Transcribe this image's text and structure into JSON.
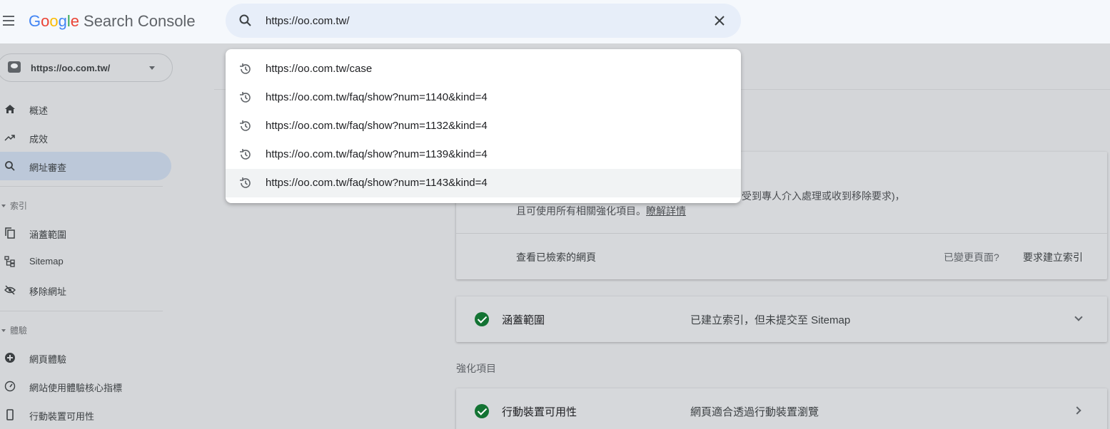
{
  "header": {
    "logo_letters": [
      "G",
      "o",
      "o",
      "g",
      "l",
      "e"
    ],
    "product_name": "Search Console",
    "search_value": "https://oo.com.tw/"
  },
  "suggestions": [
    "https://oo.com.tw/case",
    "https://oo.com.tw/faq/show?num=1140&kind=4",
    "https://oo.com.tw/faq/show?num=1132&kind=4",
    "https://oo.com.tw/faq/show?num=1139&kind=4",
    "https://oo.com.tw/faq/show?num=1143&kind=4"
  ],
  "sidebar": {
    "property": "https://oo.com.tw/",
    "items": [
      {
        "label": "概述",
        "icon": "home-icon"
      },
      {
        "label": "成效",
        "icon": "trending-up-icon"
      },
      {
        "label": "網址審查",
        "icon": "search-icon",
        "active": true
      }
    ],
    "section_index": "索引",
    "index_items": [
      {
        "label": "涵蓋範圍",
        "icon": "copy-icon"
      },
      {
        "label": "Sitemap",
        "icon": "sitemap-icon"
      },
      {
        "label": "移除網址",
        "icon": "eye-off-icon"
      }
    ],
    "section_experience": "體驗",
    "experience_items": [
      {
        "label": "網頁體驗",
        "icon": "plus-circle-icon"
      },
      {
        "label": "網站使用體驗核心指標",
        "icon": "speedometer-icon"
      },
      {
        "label": "行動裝置可用性",
        "icon": "phone-icon"
      }
    ]
  },
  "main": {
    "card1": {
      "line1": "受到專人介入處理或收到移除要求)，",
      "line2": "且可使用所有相關強化項目。",
      "learn_more": "瞭解詳情",
      "view_crawled": "查看已檢索的網頁",
      "page_changed": "已變更頁面?",
      "request_index": "要求建立索引"
    },
    "coverage": {
      "title": "涵蓋範圍",
      "status": "已建立索引，但未提交至 Sitemap"
    },
    "enhancements_label": "強化項目",
    "mobile": {
      "title": "行動裝置可用性",
      "status": "網頁適合透過行動裝置瀏覽"
    }
  },
  "colors": {
    "google_blue": "#4285f4",
    "google_red": "#ea4335",
    "google_yellow": "#fbbc05",
    "google_green": "#34a853",
    "status_green": "#137333"
  }
}
